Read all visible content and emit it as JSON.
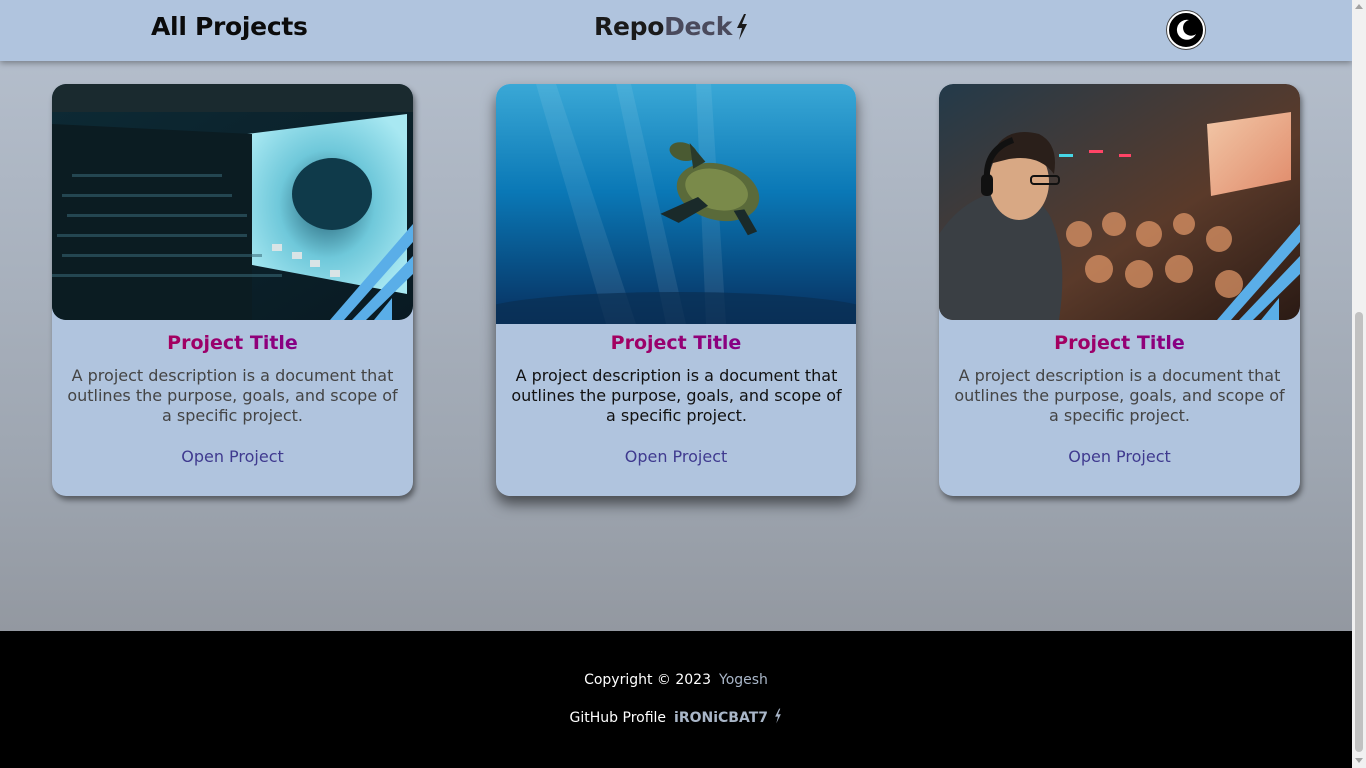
{
  "header": {
    "page_heading": "All Projects",
    "brand_part1": "Repo",
    "brand_part2": "Deck",
    "brand_icon": "lightning-bolt-icon",
    "theme_toggle_icon": "moon-icon"
  },
  "cards": [
    {
      "title": "Project Title",
      "description": "A project description is a document that outlines the purpose, goals, and scope of a specific project.",
      "link_label": "Open Project",
      "image": "concert-hall-screen-image"
    },
    {
      "title": "Project Title",
      "description": "A project description is a document that outlines the purpose, goals, and scope of a specific project.",
      "link_label": "Open Project",
      "image": "sea-turtle-underwater-image"
    },
    {
      "title": "Project Title",
      "description": "A project description is a document that outlines the purpose, goals, and scope of a specific project.",
      "link_label": "Open Project",
      "image": "gamer-audience-image"
    }
  ],
  "footer": {
    "copyright_label": "Copyright © 2023",
    "author": "Yogesh",
    "github_label": "GitHub Profile",
    "github_handle": "iRONiCBAT7"
  },
  "colors": {
    "header_bg": "#b0c4de",
    "card_bg": "#b0c4de",
    "title_gradient_start": "#c0003c",
    "title_gradient_end": "#6a00a8",
    "link": "#3f3a8f",
    "footer_bg": "#000000",
    "accent_stripes": "#5aaee8"
  }
}
